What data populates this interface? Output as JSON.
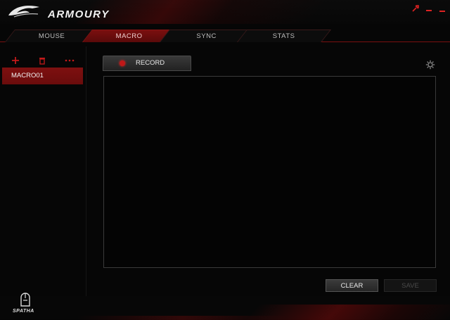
{
  "app": {
    "brand": "ARMOURY"
  },
  "tabs": [
    {
      "label": "MOUSE"
    },
    {
      "label": "MACRO"
    },
    {
      "label": "SYNC"
    },
    {
      "label": "STATS"
    }
  ],
  "active_tab": "MACRO",
  "macro_list": {
    "items": [
      {
        "label": "MACRO01"
      }
    ]
  },
  "record": {
    "label": "RECORD"
  },
  "actions": {
    "clear_label": "CLEAR",
    "save_label": "SAVE"
  },
  "device": {
    "label": "SPATHA"
  },
  "colors": {
    "accent": "#7e1010",
    "record_dot": "#c01818",
    "background": "#060606"
  },
  "icons": {
    "add": "plus-icon",
    "delete": "trash-icon",
    "more": "more-icon",
    "settings": "gear-icon",
    "minimize": "minimize-icon",
    "tools": "wrench-icon"
  }
}
